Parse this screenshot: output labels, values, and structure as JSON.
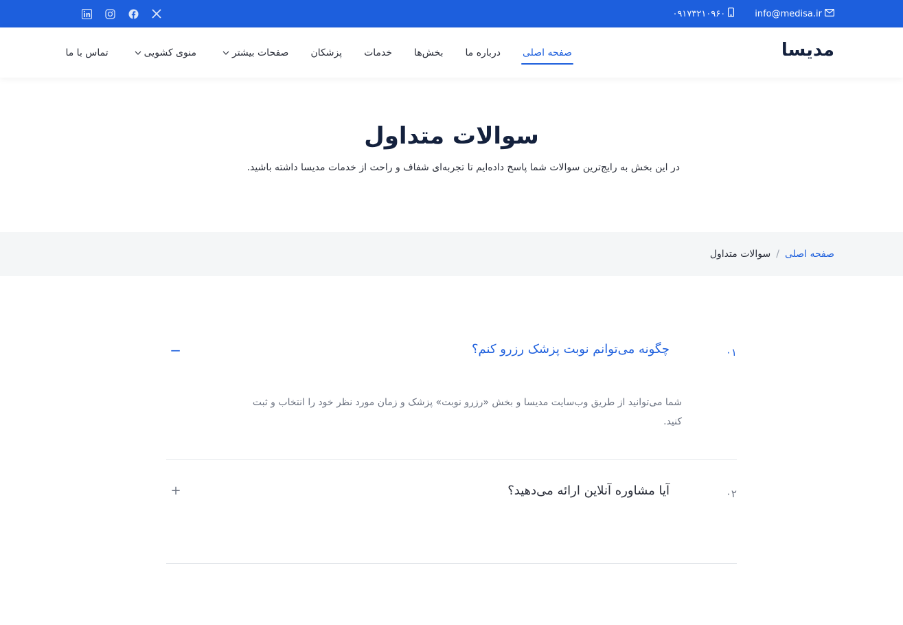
{
  "topbar": {
    "email": "info@medisa.ir",
    "phone": "۰۹۱۷۳۲۱۰۹۶۰",
    "icons": {
      "email": "envelope-icon",
      "phone": "phone-icon"
    },
    "social": [
      "linkedin-icon",
      "instagram-icon",
      "facebook-icon",
      "x-icon"
    ]
  },
  "header": {
    "logo": "مدیسا",
    "nav": [
      {
        "label": "صفحه اصلی",
        "active": true
      },
      {
        "label": "درباره ما"
      },
      {
        "label": "بخش‌ها"
      },
      {
        "label": "خدمات"
      },
      {
        "label": "پزشکان"
      },
      {
        "label": "صفحات بیشتر",
        "dropdown": true
      },
      {
        "label": "منوی کشویی",
        "dropdown": true
      },
      {
        "label": "تماس با ما"
      }
    ]
  },
  "hero": {
    "title": "سوالات متداول",
    "subtitle": "در این بخش به رایج‌ترین سوالات شما پاسخ داده‌ایم تا تجربه‌ای شفاف و راحت از خدمات مدیسا داشته باشید."
  },
  "breadcrumb": {
    "home": "صفحه اصلی",
    "separator": "/",
    "current": "سوالات متداول"
  },
  "faq": [
    {
      "number": "۰۱",
      "question": "چگونه می‌توانم نوبت پزشک رزرو کنم؟",
      "answer": "شما می‌توانید از طریق وب‌سایت مدیسا و بخش «رزرو نوبت» پزشک و زمان مورد نظر خود را انتخاب و ثبت کنید.",
      "toggle": "−"
    },
    {
      "number": "۰۲",
      "question": "آیا مشاوره آنلاین ارائه می‌دهید؟",
      "toggle": "+"
    }
  ],
  "colors": {
    "primary": "#1d5fdd",
    "dark": "#14213d",
    "band": "#f4f6f7"
  }
}
